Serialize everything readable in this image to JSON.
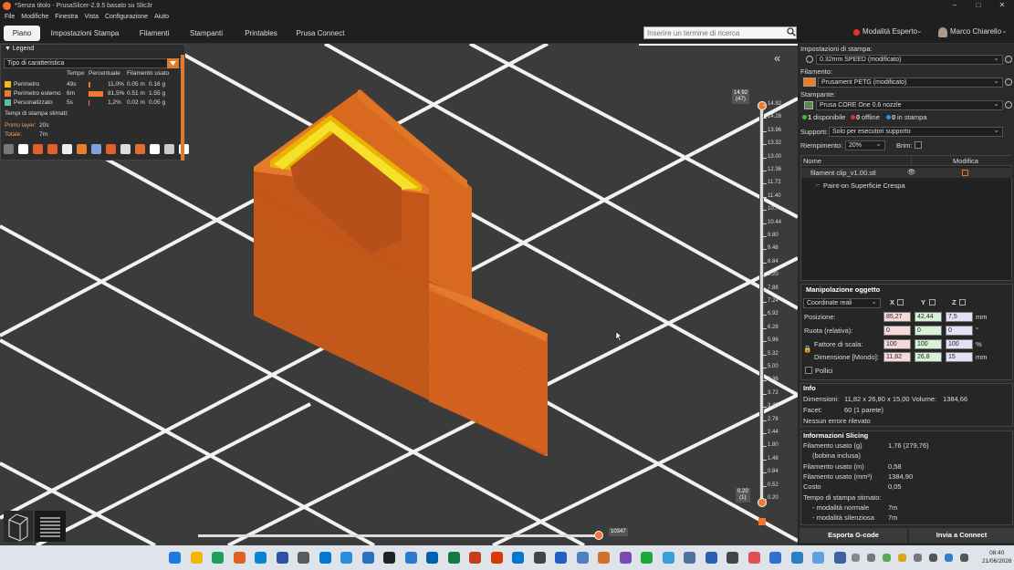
{
  "window": {
    "title": "*Senza titolo - PrusaSlicer-2.9.5 basato su Slic3r",
    "minimize": "–",
    "maximize": "□",
    "close": "✕"
  },
  "menu": [
    "File",
    "Modifiche",
    "Finestra",
    "Vista",
    "Configurazione",
    "Aiuto"
  ],
  "tabs": [
    "Piano",
    "Impostazioni Stampa",
    "Filamenti",
    "Stampanti",
    "Printables",
    "Prusa Connect"
  ],
  "search": {
    "placeholder": "Inserire un termine di ricerca"
  },
  "mode": {
    "label": "Modalità Esperto",
    "color": "#e83030"
  },
  "user": {
    "name": "Marco Chiarello"
  },
  "legend": {
    "title": "Legend",
    "type_label": "Tipo di caratteristica",
    "columns": [
      "Tempo",
      "Percentuale",
      "Filamento usato"
    ],
    "rows": [
      {
        "name": "Perimetro",
        "time": "49s",
        "pct": "11,0%",
        "len": "0.05 m",
        "mass": "0.16 g",
        "color": "#f5b820",
        "bar": 0.11
      },
      {
        "name": "Perimetro esterno",
        "time": "6m",
        "pct": "81,5%",
        "len": "0.51 m",
        "mass": "1.55 g",
        "color": "#f07830",
        "bar": 0.815
      },
      {
        "name": "Personalizzato",
        "time": "5s",
        "pct": "1,2%",
        "len": "0.02 m",
        "mass": "0.05 g",
        "color": "#5cc0a0",
        "bar": 0.012
      }
    ],
    "est_label": "Tempi di stampa stimati:",
    "first_layer_label": "Primo layer:",
    "first_layer": "20s",
    "total_label": "Totale:",
    "total": "7m"
  },
  "slider": {
    "top_label": "14.92",
    "top_layer": "(47)",
    "bottom_label": "0.20",
    "bottom_layer": "(1)",
    "ticks": [
      "14.92",
      "14.28",
      "13.96",
      "13.32",
      "13.00",
      "12.36",
      "11.72",
      "11.40",
      "10.76",
      "10.44",
      "9.80",
      "9.48",
      "8.84",
      "8.20",
      "7.88",
      "7.24",
      "6.92",
      "6.28",
      "5.96",
      "5.32",
      "5.00",
      "4.36",
      "3.72",
      "3.40",
      "2.76",
      "2.44",
      "1.80",
      "1.48",
      "0.84",
      "0.52",
      "0.20"
    ],
    "h_value": "10347"
  },
  "print_settings": {
    "label": "Impostazioni di stampa:",
    "value": "0.32mm SPEED (modificato)",
    "filament_label": "Filamento:",
    "filament": "Prusament PETG (modificato)",
    "filament_color": "#f07a20",
    "printer_label": "Stampante:",
    "printer": "Prusa CORE One 0.6 nozzle",
    "status": [
      {
        "count": "1",
        "text": "disponibile",
        "color": "#3cc03c"
      },
      {
        "count": "0",
        "text": "offline",
        "color": "#e03030"
      },
      {
        "count": "0",
        "text": "in stampa",
        "color": "#3090e0"
      }
    ],
    "supports_label": "Supporti:",
    "supports": "Solo per esecutori supporto",
    "infill_label": "Riempimento:",
    "infill": "20%",
    "brim_label": "Brim:"
  },
  "objects": {
    "col_name": "Nome",
    "col_edit": "Modifica",
    "file": "filament clip_v1.00.stl",
    "child": "Paint-on Superficie Crespa"
  },
  "manip": {
    "title": "Manipolazione oggetto",
    "coords": "Coordinate reali",
    "axes": [
      "X",
      "Y",
      "Z"
    ],
    "pos_label": "Posizione:",
    "pos": [
      "85,27",
      "42,44",
      "7,5"
    ],
    "pos_unit": "mm",
    "rot_label": "Ruota (relativa):",
    "rot": [
      "0",
      "0",
      "0"
    ],
    "rot_unit": "°",
    "scale_label": "Fattore di scala:",
    "scale": [
      "100",
      "100",
      "100"
    ],
    "scale_unit": "%",
    "dim_label": "Dimensione [Mondo]:",
    "dim": [
      "11,82",
      "26,8",
      "15"
    ],
    "dim_unit": "mm",
    "inches": "Pollici"
  },
  "info": {
    "title": "Info",
    "dims_label": "Dimensioni:",
    "dims": "11,82 x 26,80 x 15,00",
    "volume_label": "Volume:",
    "volume": "1384,66",
    "facets_label": "Facet:",
    "facets": "60 (1 parete)",
    "errors": "Nessun errore rilevato"
  },
  "slicing": {
    "title": "Informazioni Slicing",
    "rows": [
      {
        "label": "Filamento usato (g)",
        "value": "1,76 (279,76)"
      },
      {
        "label": "(bobina inclusa)",
        "value": ""
      },
      {
        "label": "Filamento usato (m)",
        "value": "0,58"
      },
      {
        "label": "Filamento usato (mm³)",
        "value": "1384,90"
      },
      {
        "label": "Costo",
        "value": "0,05"
      },
      {
        "label": "Tempo di stampa stimato:",
        "value": ""
      },
      {
        "label": "- modalità normale",
        "value": "7m"
      },
      {
        "label": "- modalità silenziosa",
        "value": "7m"
      }
    ]
  },
  "buttons": {
    "export": "Esporta G-code",
    "send": "Invia a Connect"
  },
  "clock": {
    "time": "08:40",
    "date": "21/06/2026"
  }
}
